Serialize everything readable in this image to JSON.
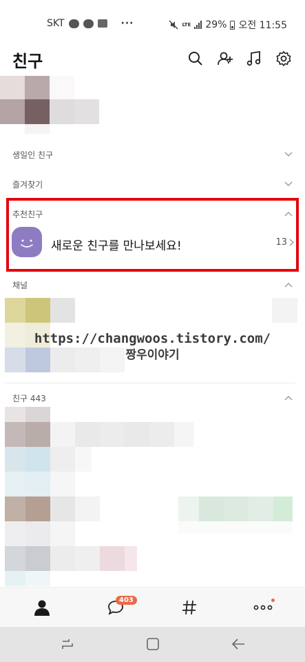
{
  "status_bar": {
    "carrier": "SKT",
    "more_indicator": "···",
    "network": "LTE",
    "battery_percent": "29%",
    "time": "오전 11:55",
    "icons": [
      "talk-bubble-icon",
      "smiley-notification-icon",
      "gallery-icon",
      "mute-icon",
      "signal-icon",
      "battery-icon"
    ]
  },
  "header": {
    "title": "친구",
    "icons": [
      "search-icon",
      "add-friend-icon",
      "music-icon",
      "settings-icon"
    ]
  },
  "sections": {
    "birthday": "생일인 친구",
    "favorites": "즐겨찾기",
    "recommended": "추천친구",
    "channel": "채널",
    "friends": "친구 443"
  },
  "recommended_item": {
    "text": "새로운 친구를 만나보세요!",
    "count": "13"
  },
  "watermark": {
    "url": "https://changwoos.tistory.com/",
    "name": "짱우이야기"
  },
  "tab_bar": {
    "chat_badge": "403",
    "accent_color": "#e96a4a"
  },
  "highlight_color": "#e4050d",
  "nav_bar": {
    "icons": [
      "recent-apps-icon",
      "home-icon",
      "back-icon"
    ]
  }
}
